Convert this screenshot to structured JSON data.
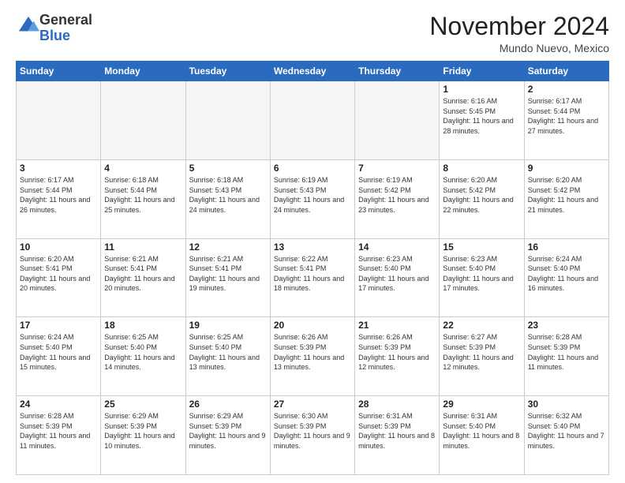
{
  "logo": {
    "general": "General",
    "blue": "Blue"
  },
  "header": {
    "month_title": "November 2024",
    "subtitle": "Mundo Nuevo, Mexico"
  },
  "days_of_week": [
    "Sunday",
    "Monday",
    "Tuesday",
    "Wednesday",
    "Thursday",
    "Friday",
    "Saturday"
  ],
  "weeks": [
    [
      {
        "day": "",
        "info": ""
      },
      {
        "day": "",
        "info": ""
      },
      {
        "day": "",
        "info": ""
      },
      {
        "day": "",
        "info": ""
      },
      {
        "day": "",
        "info": ""
      },
      {
        "day": "1",
        "info": "Sunrise: 6:16 AM\nSunset: 5:45 PM\nDaylight: 11 hours and 28 minutes."
      },
      {
        "day": "2",
        "info": "Sunrise: 6:17 AM\nSunset: 5:44 PM\nDaylight: 11 hours and 27 minutes."
      }
    ],
    [
      {
        "day": "3",
        "info": "Sunrise: 6:17 AM\nSunset: 5:44 PM\nDaylight: 11 hours and 26 minutes."
      },
      {
        "day": "4",
        "info": "Sunrise: 6:18 AM\nSunset: 5:44 PM\nDaylight: 11 hours and 25 minutes."
      },
      {
        "day": "5",
        "info": "Sunrise: 6:18 AM\nSunset: 5:43 PM\nDaylight: 11 hours and 24 minutes."
      },
      {
        "day": "6",
        "info": "Sunrise: 6:19 AM\nSunset: 5:43 PM\nDaylight: 11 hours and 24 minutes."
      },
      {
        "day": "7",
        "info": "Sunrise: 6:19 AM\nSunset: 5:42 PM\nDaylight: 11 hours and 23 minutes."
      },
      {
        "day": "8",
        "info": "Sunrise: 6:20 AM\nSunset: 5:42 PM\nDaylight: 11 hours and 22 minutes."
      },
      {
        "day": "9",
        "info": "Sunrise: 6:20 AM\nSunset: 5:42 PM\nDaylight: 11 hours and 21 minutes."
      }
    ],
    [
      {
        "day": "10",
        "info": "Sunrise: 6:20 AM\nSunset: 5:41 PM\nDaylight: 11 hours and 20 minutes."
      },
      {
        "day": "11",
        "info": "Sunrise: 6:21 AM\nSunset: 5:41 PM\nDaylight: 11 hours and 20 minutes."
      },
      {
        "day": "12",
        "info": "Sunrise: 6:21 AM\nSunset: 5:41 PM\nDaylight: 11 hours and 19 minutes."
      },
      {
        "day": "13",
        "info": "Sunrise: 6:22 AM\nSunset: 5:41 PM\nDaylight: 11 hours and 18 minutes."
      },
      {
        "day": "14",
        "info": "Sunrise: 6:23 AM\nSunset: 5:40 PM\nDaylight: 11 hours and 17 minutes."
      },
      {
        "day": "15",
        "info": "Sunrise: 6:23 AM\nSunset: 5:40 PM\nDaylight: 11 hours and 17 minutes."
      },
      {
        "day": "16",
        "info": "Sunrise: 6:24 AM\nSunset: 5:40 PM\nDaylight: 11 hours and 16 minutes."
      }
    ],
    [
      {
        "day": "17",
        "info": "Sunrise: 6:24 AM\nSunset: 5:40 PM\nDaylight: 11 hours and 15 minutes."
      },
      {
        "day": "18",
        "info": "Sunrise: 6:25 AM\nSunset: 5:40 PM\nDaylight: 11 hours and 14 minutes."
      },
      {
        "day": "19",
        "info": "Sunrise: 6:25 AM\nSunset: 5:40 PM\nDaylight: 11 hours and 13 minutes."
      },
      {
        "day": "20",
        "info": "Sunrise: 6:26 AM\nSunset: 5:39 PM\nDaylight: 11 hours and 13 minutes."
      },
      {
        "day": "21",
        "info": "Sunrise: 6:26 AM\nSunset: 5:39 PM\nDaylight: 11 hours and 12 minutes."
      },
      {
        "day": "22",
        "info": "Sunrise: 6:27 AM\nSunset: 5:39 PM\nDaylight: 11 hours and 12 minutes."
      },
      {
        "day": "23",
        "info": "Sunrise: 6:28 AM\nSunset: 5:39 PM\nDaylight: 11 hours and 11 minutes."
      }
    ],
    [
      {
        "day": "24",
        "info": "Sunrise: 6:28 AM\nSunset: 5:39 PM\nDaylight: 11 hours and 11 minutes."
      },
      {
        "day": "25",
        "info": "Sunrise: 6:29 AM\nSunset: 5:39 PM\nDaylight: 11 hours and 10 minutes."
      },
      {
        "day": "26",
        "info": "Sunrise: 6:29 AM\nSunset: 5:39 PM\nDaylight: 11 hours and 9 minutes."
      },
      {
        "day": "27",
        "info": "Sunrise: 6:30 AM\nSunset: 5:39 PM\nDaylight: 11 hours and 9 minutes."
      },
      {
        "day": "28",
        "info": "Sunrise: 6:31 AM\nSunset: 5:39 PM\nDaylight: 11 hours and 8 minutes."
      },
      {
        "day": "29",
        "info": "Sunrise: 6:31 AM\nSunset: 5:40 PM\nDaylight: 11 hours and 8 minutes."
      },
      {
        "day": "30",
        "info": "Sunrise: 6:32 AM\nSunset: 5:40 PM\nDaylight: 11 hours and 7 minutes."
      }
    ]
  ]
}
